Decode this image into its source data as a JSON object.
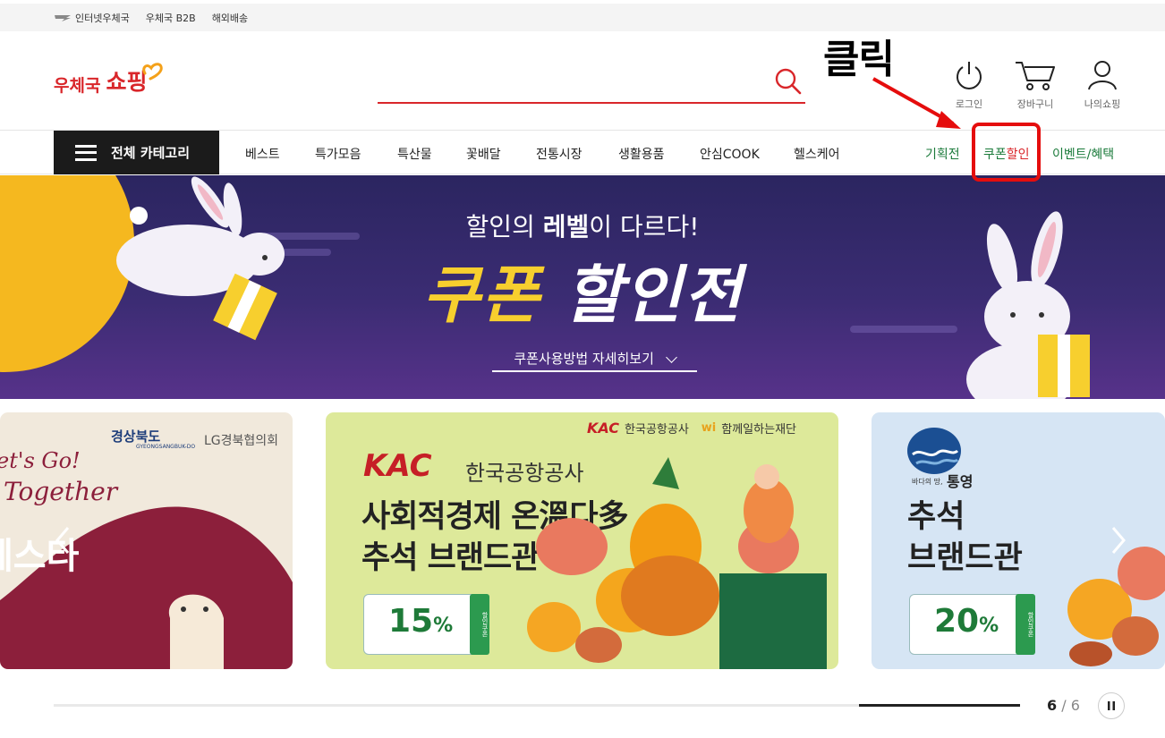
{
  "topbar": {
    "links": [
      "인터넷우체국",
      "우체국 B2B",
      "해외배송"
    ]
  },
  "header": {
    "logo_part1": "우체국",
    "logo_part2": "쇼핑",
    "search_value": "",
    "icons": [
      {
        "name": "power-icon",
        "label": "로그인"
      },
      {
        "name": "cart-icon",
        "label": "장바구니"
      },
      {
        "name": "person-icon",
        "label": "나의쇼핑"
      }
    ]
  },
  "annotation": {
    "text": "클릭",
    "color": "#e50d0d"
  },
  "nav": {
    "all_category": "전체 카테고리",
    "items": [
      "베스트",
      "특가모음",
      "특산물",
      "꽃배달",
      "전통시장",
      "생활용품",
      "안심COOK",
      "헬스케어"
    ],
    "right_items": [
      "기획전",
      "쿠폰",
      "할인",
      "이벤트/혜택"
    ]
  },
  "banner": {
    "headline_pre": "할인의 ",
    "headline_bold": "레벨",
    "headline_post": "이 다르다!",
    "title_1": "쿠폰",
    "title_2": "할인전",
    "link": "쿠폰사용방법 자세히보기"
  },
  "cards": {
    "left": {
      "org1": "경상북도",
      "org1_sub": "GYEONGSANGBUK-DO",
      "org2": "LG경북협의회",
      "script1": "et's Go!",
      "script2": "Together",
      "title": "페스타"
    },
    "mid": {
      "header_kac": "KAC",
      "header_org": "한국공항공사",
      "header_wi": "wi",
      "header_foundation": "함께일하는재단",
      "logo_kac": "KAC",
      "logo_org": "한국공항공사",
      "line1": "사회적경제 온溫다多",
      "line2": "추석 브랜드관",
      "pct_num": "15",
      "pct_unit": "%",
      "tab": "할인쿠폰"
    },
    "right": {
      "logo_caption": "바다의 땅,",
      "logo_city": "통영",
      "line1": "추석",
      "line2": "브랜드관",
      "pct_num": "20",
      "pct_unit": "%",
      "tab": "할인쿠폰"
    }
  },
  "pager": {
    "current": "6",
    "separator": " / ",
    "total": "6",
    "progress": 1.0
  },
  "colors": {
    "brand_red": "#d9262a",
    "nav_green": "#1a7a3a",
    "banner_purple": "#3b2c73",
    "banner_yellow": "#f7cf2e"
  }
}
